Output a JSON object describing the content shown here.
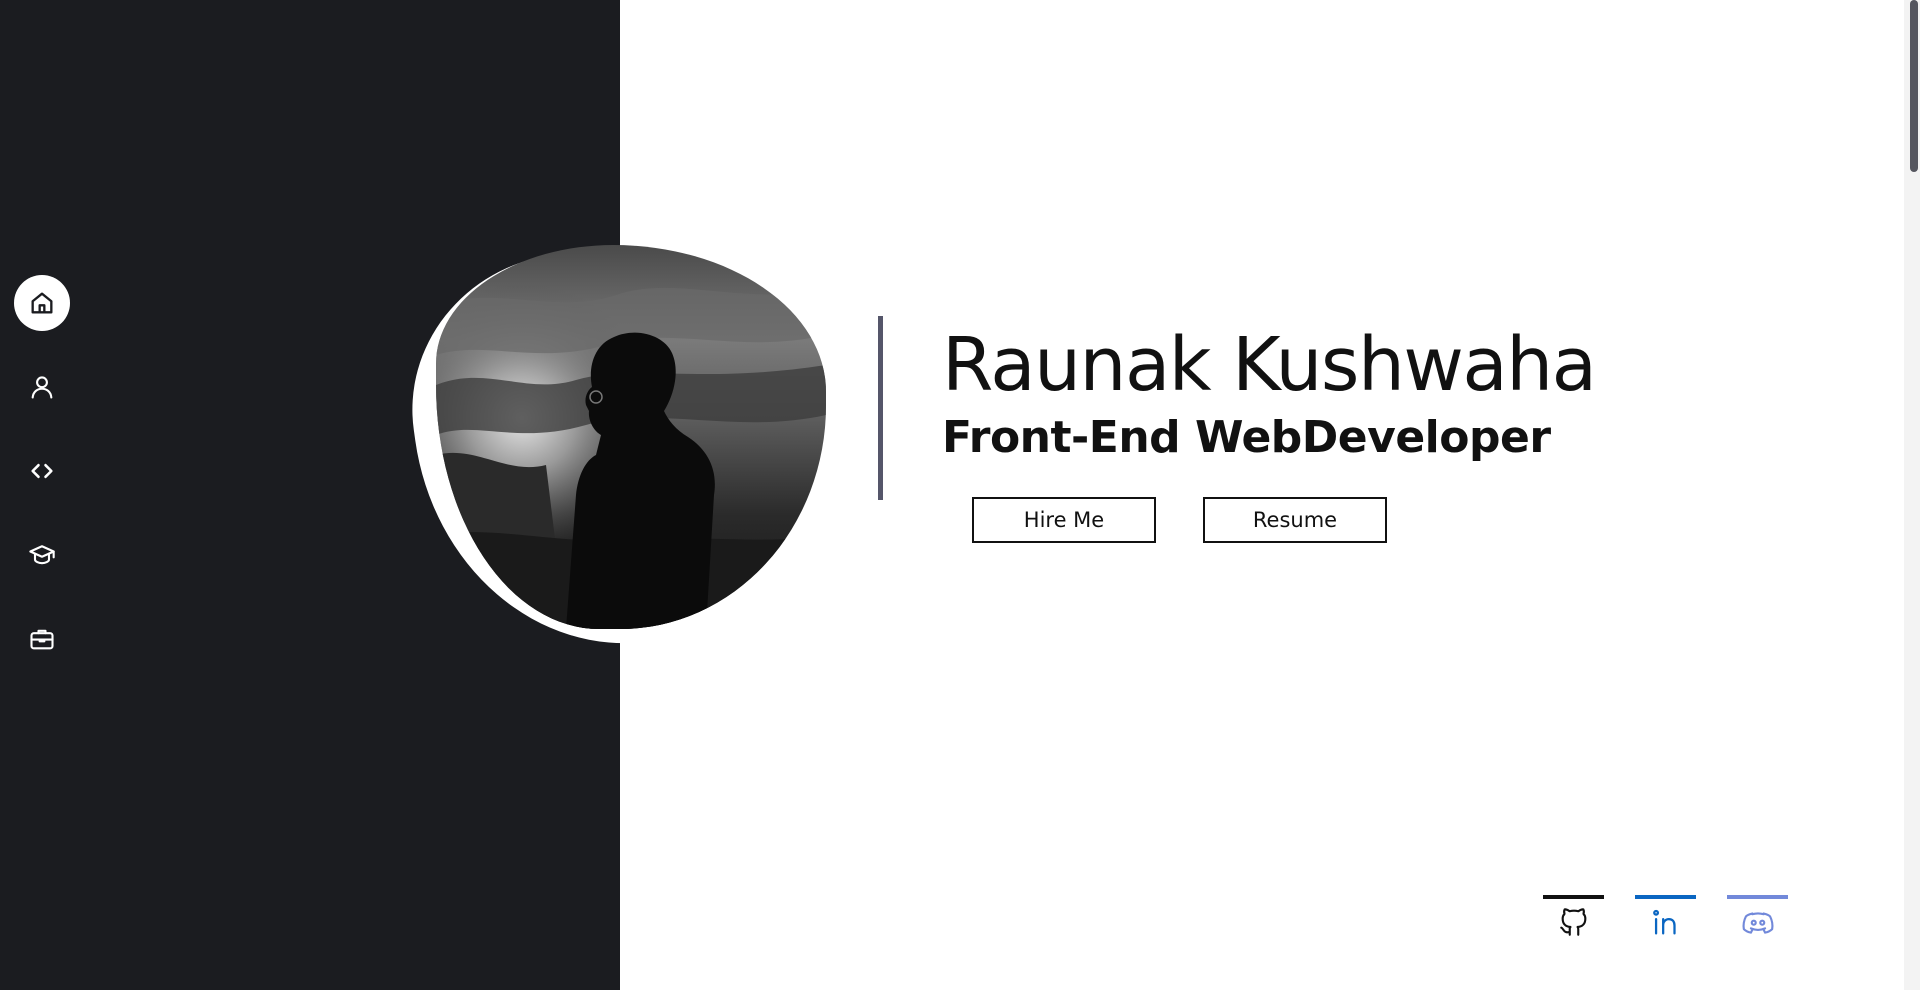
{
  "hero": {
    "name": "Raunak Kushwaha",
    "role": "Front-End WebDeveloper",
    "hire_label": "Hire Me",
    "resume_label": "Resume"
  },
  "nav": {
    "items": [
      {
        "icon": "home-icon",
        "active": true
      },
      {
        "icon": "user-icon",
        "active": false
      },
      {
        "icon": "code-icon",
        "active": false
      },
      {
        "icon": "graduation-cap-icon",
        "active": false
      },
      {
        "icon": "briefcase-icon",
        "active": false
      }
    ]
  },
  "socials": [
    {
      "icon": "github-icon",
      "color": "#111111"
    },
    {
      "icon": "linkedin-icon",
      "color": "#0a66c2"
    },
    {
      "icon": "discord-icon",
      "color": "#7289da"
    }
  ],
  "colors": {
    "sidebar_bg": "#1b1c20",
    "accent_line": "#55566a"
  }
}
